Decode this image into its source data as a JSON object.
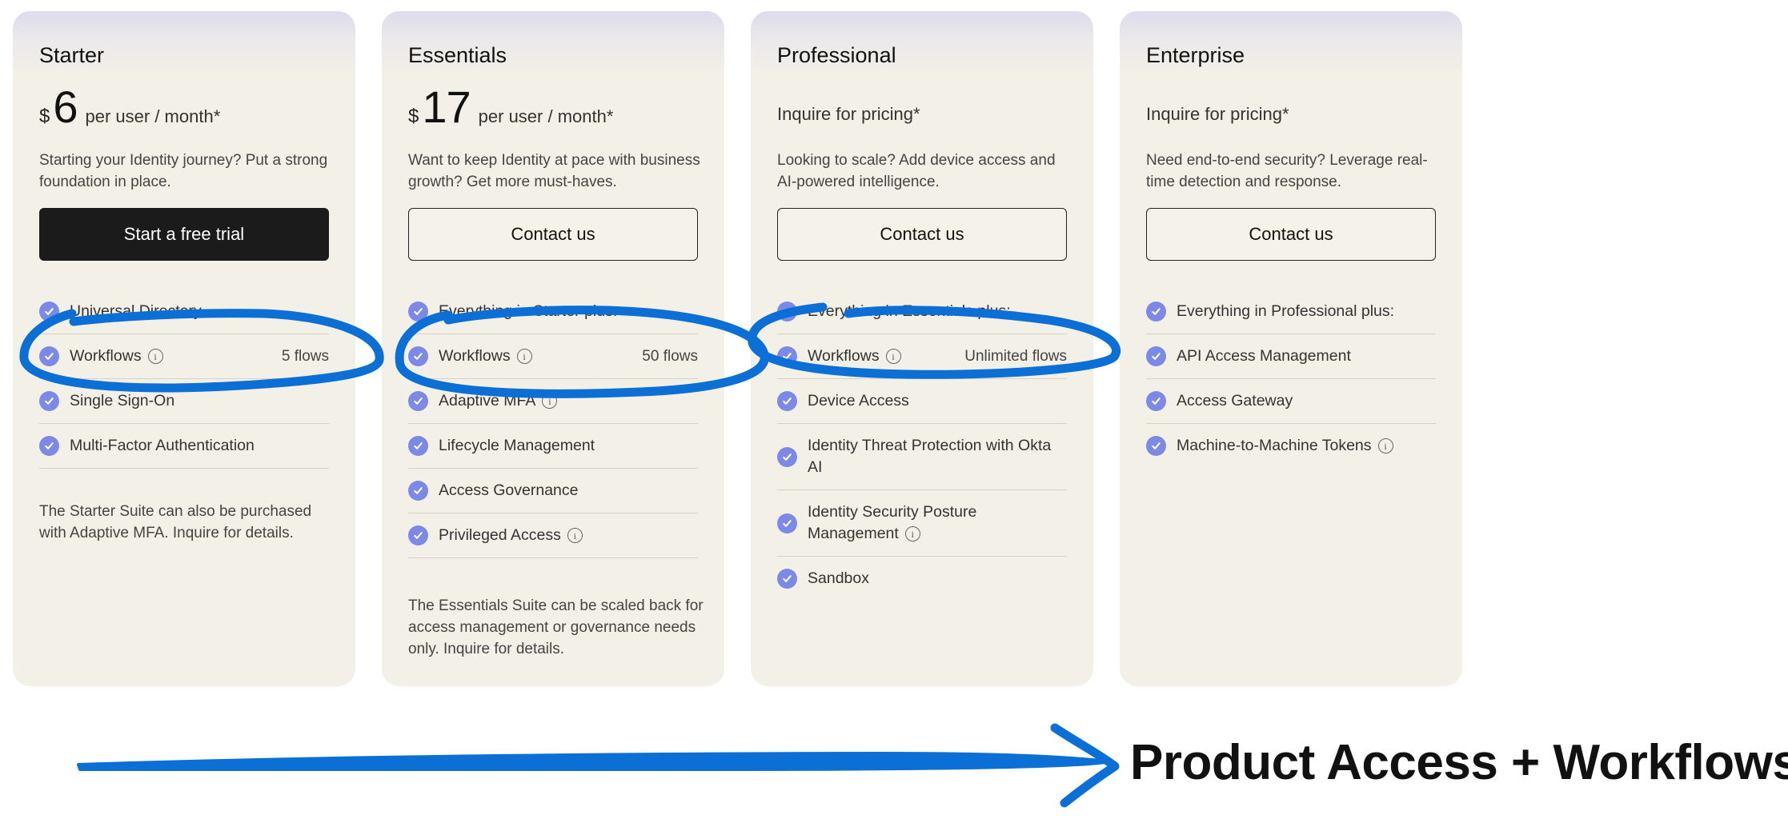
{
  "plans": [
    {
      "name": "Starter",
      "currency": "$",
      "price": "6",
      "price_unit": "per user / month*",
      "description": "Starting your Identity journey? Put a strong foundation in place.",
      "cta": "Start a free trial",
      "features": [
        {
          "label": "Universal Directory"
        },
        {
          "label": "Workflows",
          "value": "5 flows"
        },
        {
          "label": "Single Sign-On"
        },
        {
          "label": "Multi-Factor Authentication"
        }
      ],
      "note": "The Starter Suite can also be purchased with Adaptive MFA. Inquire for details."
    },
    {
      "name": "Essentials",
      "currency": "$",
      "price": "17",
      "price_unit": "per user / month*",
      "description": "Want to keep Identity at pace with business growth? Get more must-haves.",
      "cta": "Contact us",
      "features": [
        {
          "label": "Everything in Starter plus:"
        },
        {
          "label": "Workflows",
          "value": "50 flows"
        },
        {
          "label": "Adaptive MFA"
        },
        {
          "label": "Lifecycle Management"
        },
        {
          "label": "Access Governance"
        },
        {
          "label": "Privileged Access"
        }
      ],
      "note": "The Essentials Suite can be scaled back for access management or governance needs only. Inquire for details."
    },
    {
      "name": "Professional",
      "pricing_text": "Inquire for pricing*",
      "description": "Looking to scale? Add device access and AI-powered intelligence.",
      "cta": "Contact us",
      "features": [
        {
          "label": "Everything in Essentials plus:"
        },
        {
          "label": "Workflows",
          "value": "Unlimited flows"
        },
        {
          "label": "Device Access"
        },
        {
          "label": "Identity Threat Protection with Okta AI"
        },
        {
          "label": "Identity Security Posture Management"
        },
        {
          "label": "Sandbox"
        }
      ]
    },
    {
      "name": "Enterprise",
      "pricing_text": "Inquire for pricing*",
      "description": "Need end-to-end security? Leverage real-time detection and response.",
      "cta": "Contact us",
      "features": [
        {
          "label": "Everything in Professional plus:"
        },
        {
          "label": "API Access Management"
        },
        {
          "label": "Access Gateway"
        },
        {
          "label": "Machine-to-Machine Tokens"
        }
      ]
    }
  ],
  "annotation": {
    "banner": "Product Access + Workflows",
    "stroke_color": "#0b6fd6"
  },
  "colors": {
    "check": "#7c89e6",
    "cta_dark": "#1b1b1b",
    "card_bg": "#f3f0e8"
  }
}
